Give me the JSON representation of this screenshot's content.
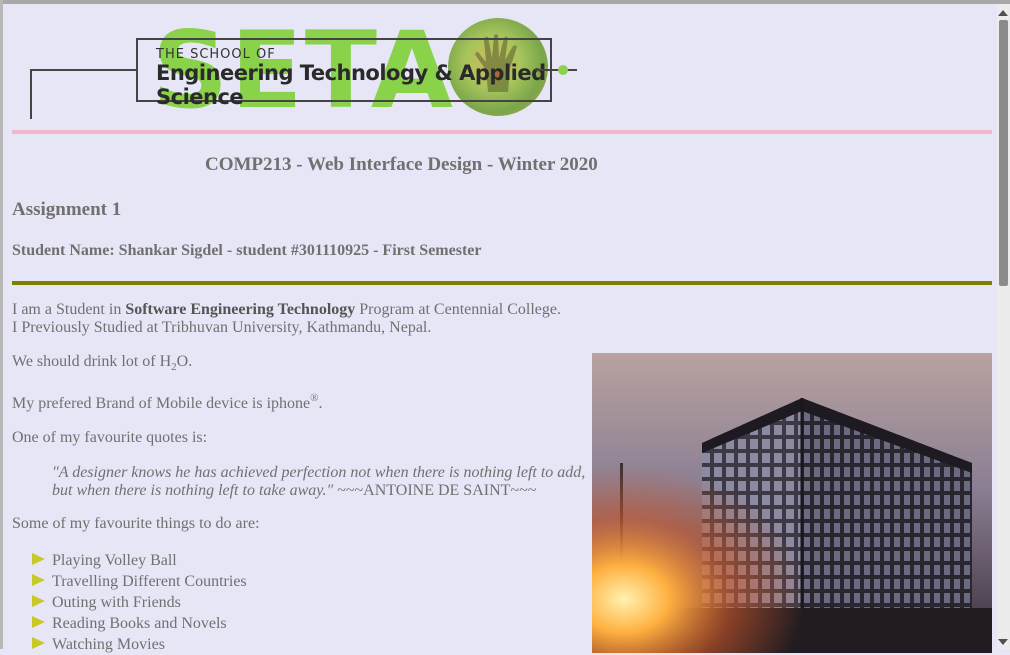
{
  "banner": {
    "big_letters": "SETAS",
    "school_line": "THE SCHOOL OF",
    "engineering_line": "Engineering Technology & Applied Science"
  },
  "course_title": "COMP213 - Web Interface Design - Winter 2020",
  "assignment_title": "Assignment 1",
  "student_line": "Student Name: Shankar Sigdel - student #301110925 - First Semester",
  "intro": {
    "line1_pre": "I am a Student in ",
    "line1_bold": "Software Engineering Technology",
    "line1_post": " Program at Centennial College.",
    "line2": "I Previously Studied at Tribhuvan University, Kathmandu, Nepal."
  },
  "water": {
    "pre": "We should drink lot of H",
    "sub": "2",
    "post": "O."
  },
  "brand": {
    "pre": "My prefered Brand of Mobile device is iphone",
    "sup": "®",
    "post": "."
  },
  "quotes_intro": "One of my favourite quotes is:",
  "quote": {
    "text": "\"A designer knows he has achieved perfection not when there is nothing left to add, but when there is nothing left to take away.\"",
    "author": " ~~~ANTOINE DE SAINT~~~"
  },
  "things_intro": "Some of my favourite things to do are:",
  "things": [
    "Playing Volley Ball",
    "Travelling Different Countries",
    "Outing with Friends",
    "Reading Books and Novels",
    "Watching Movies"
  ],
  "colors": {
    "background": "#e6e6f7",
    "text": "#707070",
    "pink_rule": "#f0b8c8",
    "olive_rule": "#808000",
    "bullet": "#c8c826",
    "logo_green": "#8ad24a"
  },
  "icons": {
    "bullet": "yellow-triangle-bullet-icon",
    "logo_hand": "hand-icon"
  }
}
